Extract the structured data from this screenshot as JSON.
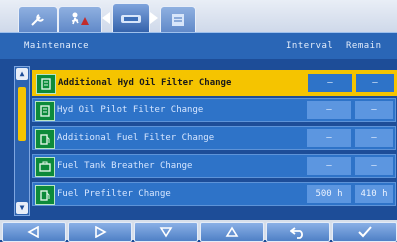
{
  "tabs": [
    {
      "name": "wrench-tab",
      "icon": "wrench-icon"
    },
    {
      "name": "service-tab",
      "icon": "service-icon"
    },
    {
      "name": "maintenance-tab",
      "icon": "maintenance-icon",
      "active": true
    },
    {
      "name": "document-tab",
      "icon": "document-icon"
    }
  ],
  "header": {
    "title": "Maintenance",
    "interval": "Interval",
    "remain": "Remain"
  },
  "rows": [
    {
      "label": "Additional Hyd Oil Filter Change",
      "interval": "—",
      "remain": "—",
      "selected": true
    },
    {
      "label": "Hyd Oil Pilot Filter Change",
      "interval": "—",
      "remain": "—"
    },
    {
      "label": "Additional Fuel Filter Change",
      "interval": "—",
      "remain": "—"
    },
    {
      "label": "Fuel Tank Breather Change",
      "interval": "—",
      "remain": "—"
    },
    {
      "label": "Fuel Prefilter Change",
      "interval": "500 h",
      "remain": "410 h"
    }
  ],
  "colors": {
    "background": "#1d4d98",
    "selected": "#f5c400",
    "icon_green": "#0d8a3a"
  },
  "buttons": [
    {
      "icon": "arrow-left-icon"
    },
    {
      "icon": "arrow-right-icon"
    },
    {
      "icon": "arrow-down-icon"
    },
    {
      "icon": "arrow-up-icon"
    },
    {
      "icon": "back-icon"
    },
    {
      "icon": "checkmark-icon"
    }
  ]
}
